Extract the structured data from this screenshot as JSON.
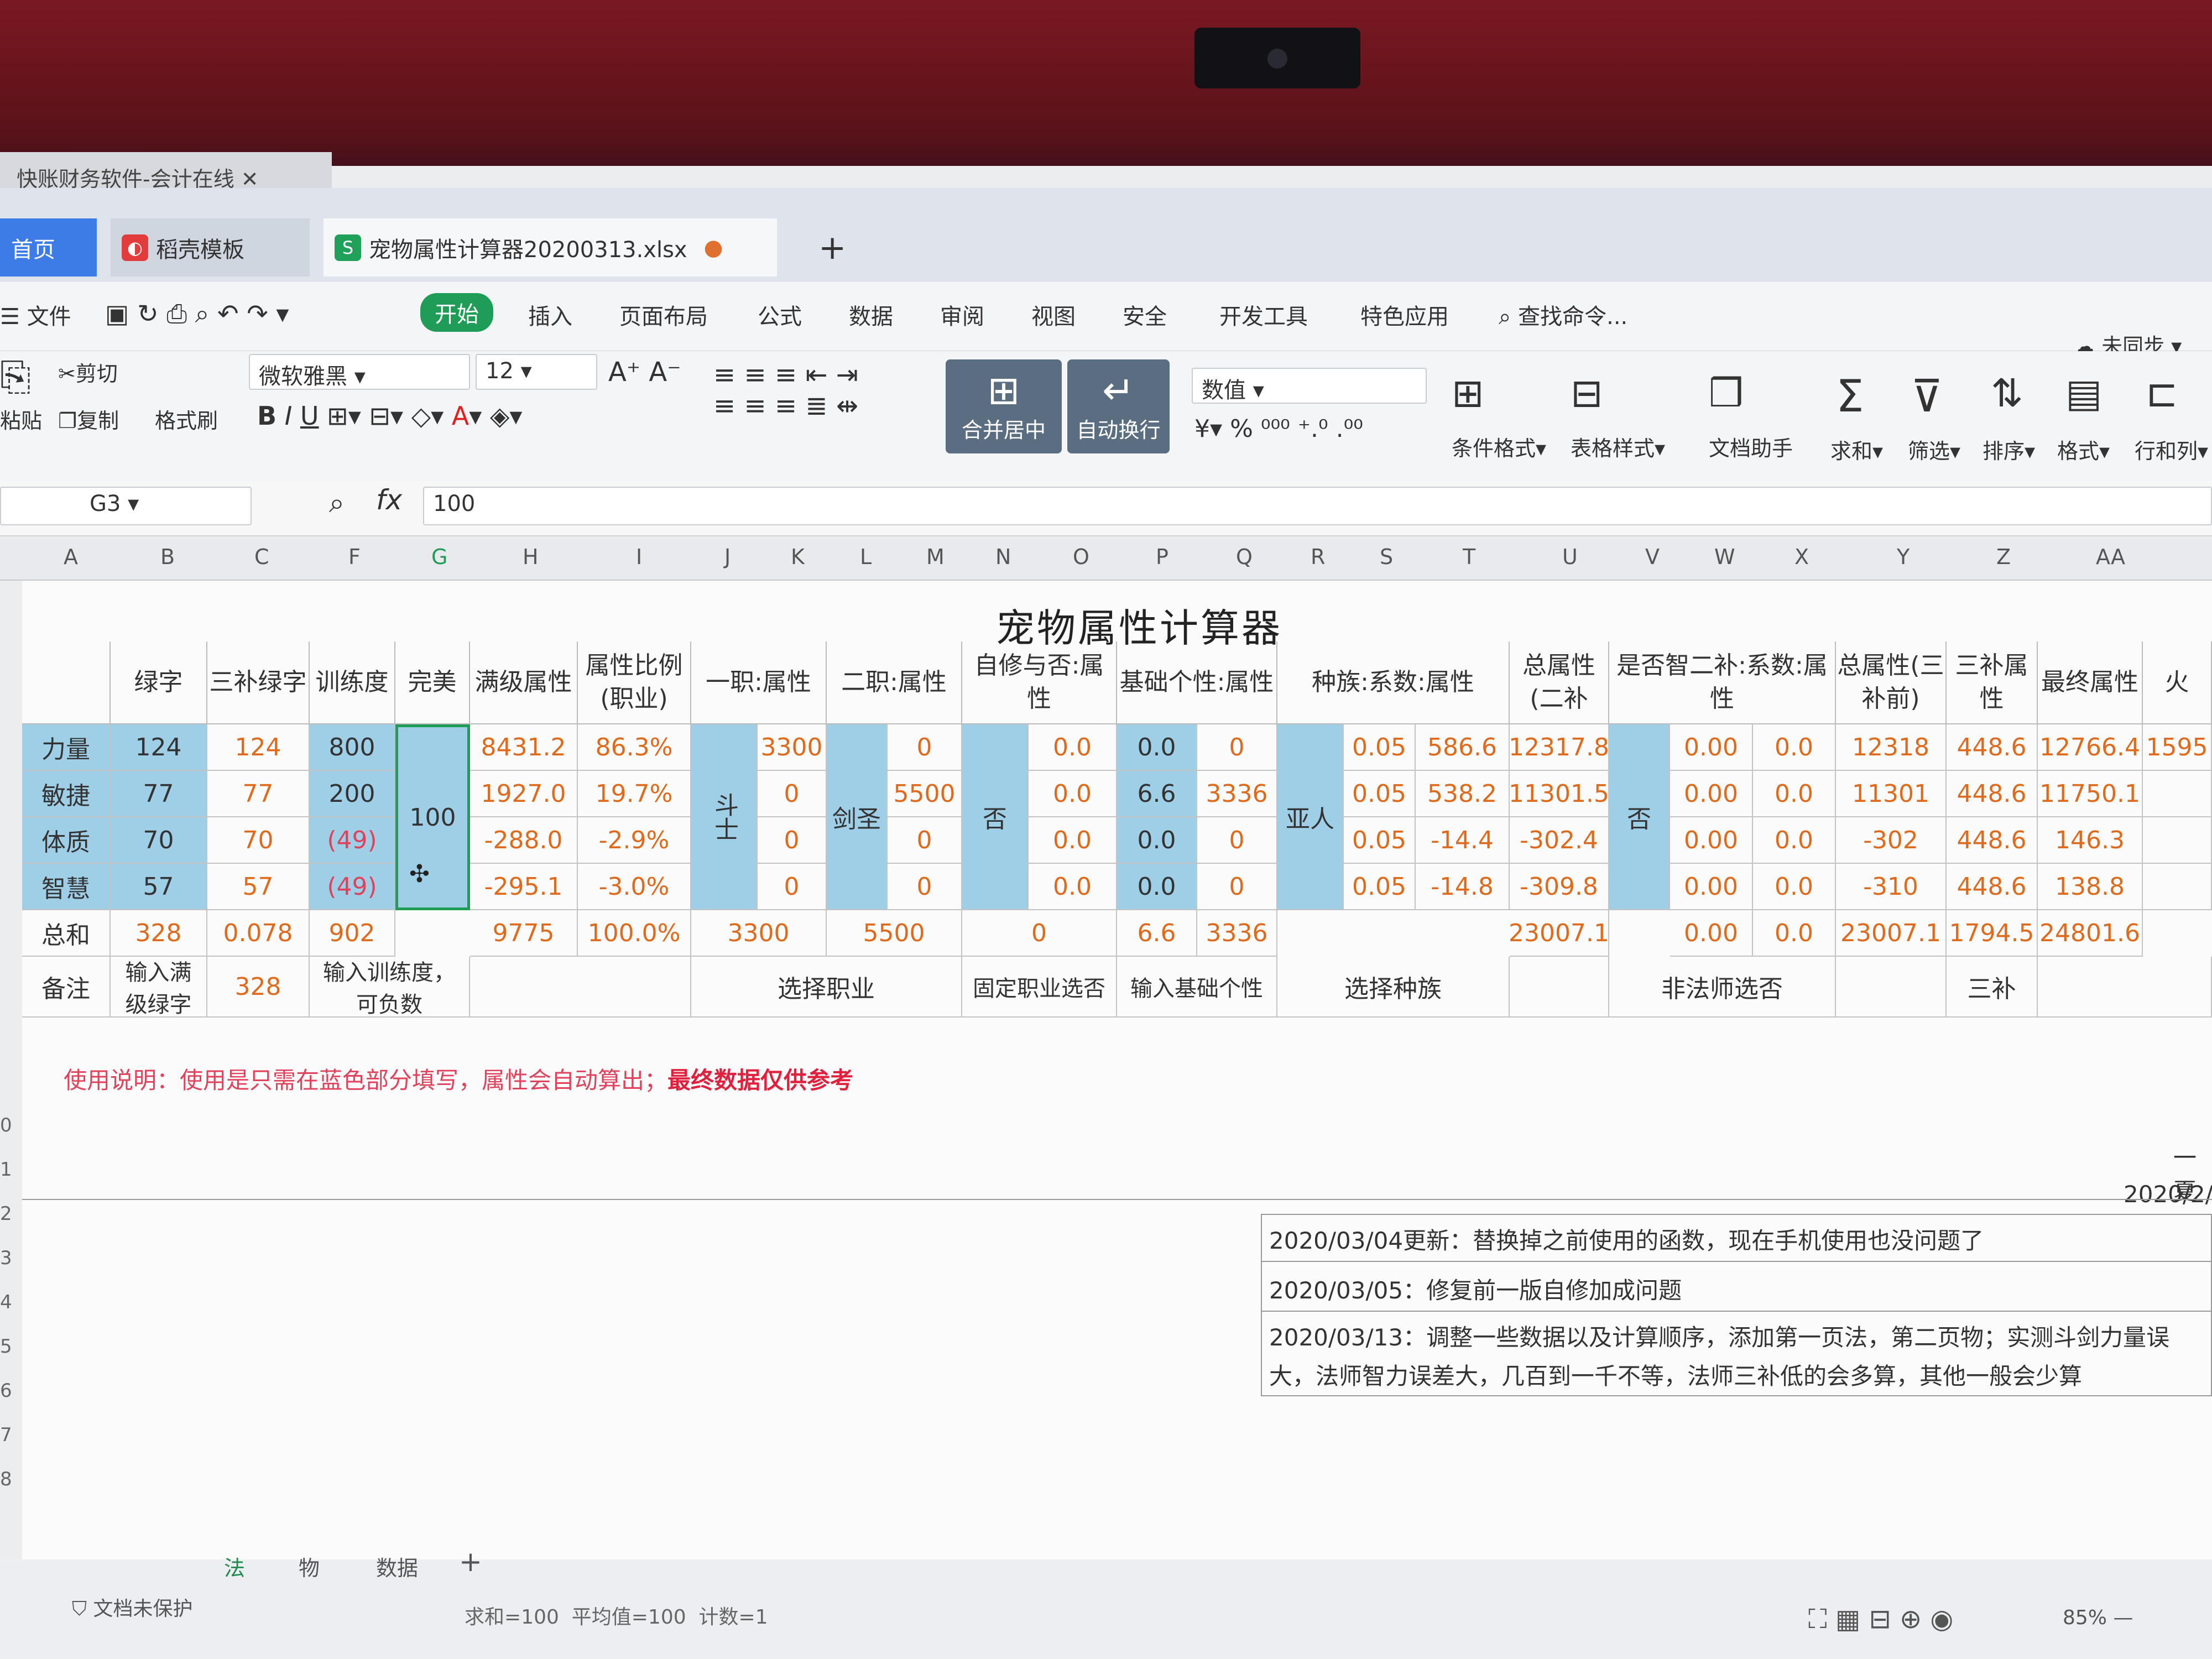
{
  "old_tab": {
    "title": "快账财务软件-会计在线"
  },
  "tabs": {
    "home": "首页",
    "template": "稻壳模板",
    "file": "宠物属性计算器20200313.xlsx",
    "add": "+"
  },
  "menu": {
    "file": "文件",
    "start": "开始",
    "insert": "插入",
    "layout": "页面布局",
    "formula": "公式",
    "data": "数据",
    "review": "审阅",
    "view": "视图",
    "security": "安全",
    "dev": "开发工具",
    "special": "特色应用",
    "search": "查找命令...",
    "sync": "未同步"
  },
  "toolbar": {
    "paste": "粘贴",
    "cut": "剪切",
    "copy": "复制",
    "format_painter": "格式刷",
    "font": "微软雅黑",
    "size": "12",
    "merge": "合并居中",
    "wrap": "自动换行",
    "number_format": "数值",
    "cond_format": "条件格式",
    "table_style": "表格样式",
    "doc_helper": "文档助手",
    "sum": "求和",
    "filter": "筛选",
    "sort": "排序",
    "format": "格式",
    "rowcol": "行和列"
  },
  "formula_bar": {
    "cell": "G3",
    "fx": "fx",
    "value": "100"
  },
  "columns": [
    "A",
    "B",
    "C",
    "F",
    "G",
    "H",
    "I",
    "J",
    "K",
    "L",
    "M",
    "N",
    "O",
    "P",
    "Q",
    "R",
    "S",
    "T",
    "U",
    "V",
    "W",
    "X",
    "Y",
    "Z",
    "AA"
  ],
  "sheet": {
    "title": "宠物属性计算器",
    "headers": {
      "b": "绿字",
      "c": "三补绿字",
      "f": "训练度",
      "g": "完美",
      "h": "满级属性",
      "i": "属性比例(职业)",
      "job1": "一职:属性",
      "job2": "二职:属性",
      "self": "自修与否:属性",
      "base": "基础个性:属性",
      "race": "种族:系数:属性",
      "total2": "总属性(二补",
      "wise": "是否智二补:系数:属性",
      "total3": "总属性(三补前)",
      "b3": "三补属性",
      "final": "最终属性",
      "fire": "火"
    },
    "rows": [
      {
        "name": "力量",
        "b": "124",
        "c": "124",
        "f": "800",
        "h": "8431.2",
        "i": "86.3%",
        "k": "3300",
        "m": "0",
        "o": "0.0",
        "p": "0.0",
        "q": "0",
        "s": "0.05",
        "t": "586.6",
        "u": "12317.8",
        "w": "0.00",
        "x": "0.0",
        "y": "12318",
        "z": "448.6",
        "aa": "12766.4",
        "ab": "1595"
      },
      {
        "name": "敏捷",
        "b": "77",
        "c": "77",
        "f": "200",
        "h": "1927.0",
        "i": "19.7%",
        "k": "0",
        "m": "5500",
        "o": "0.0",
        "p": "6.6",
        "q": "3336",
        "s": "0.05",
        "t": "538.2",
        "u": "11301.5",
        "w": "0.00",
        "x": "0.0",
        "y": "11301",
        "z": "448.6",
        "aa": "11750.1",
        "ab": ""
      },
      {
        "name": "体质",
        "b": "70",
        "c": "70",
        "f": "(49)",
        "h": "-288.0",
        "i": "-2.9%",
        "k": "0",
        "m": "0",
        "o": "0.0",
        "p": "0.0",
        "q": "0",
        "s": "0.05",
        "t": "-14.4",
        "u": "-302.4",
        "w": "0.00",
        "x": "0.0",
        "y": "-302",
        "z": "448.6",
        "aa": "146.3",
        "ab": ""
      },
      {
        "name": "智慧",
        "b": "57",
        "c": "57",
        "f": "(49)",
        "h": "-295.1",
        "i": "-3.0%",
        "k": "0",
        "m": "0",
        "o": "0.0",
        "p": "0.0",
        "q": "0",
        "s": "0.05",
        "t": "-14.8",
        "u": "-309.8",
        "w": "0.00",
        "x": "0.0",
        "y": "-310",
        "z": "448.6",
        "aa": "138.8",
        "ab": ""
      }
    ],
    "merged": {
      "perfect": "100",
      "job1": "斗士",
      "job2": "剑圣",
      "self": "否",
      "race": "亚人",
      "wise": "否"
    },
    "total": {
      "name": "总和",
      "b": "328",
      "c": "0.078",
      "f": "902",
      "h": "9775",
      "i": "100.0%",
      "k": "3300",
      "m": "5500",
      "o": "0",
      "p": "6.6",
      "q": "3336",
      "u": "23007.1",
      "w": "0.00",
      "x": "0.0",
      "y": "23007.1",
      "z": "1794.5",
      "aa": "24801.6"
    },
    "notes": {
      "name": "备注",
      "b": "输入满级绿字",
      "c": "328",
      "f": "输入训练度，可负数",
      "job": "选择职业",
      "self": "固定职业选否",
      "base": "输入基础个性",
      "race": "选择种族",
      "wise": "非法师选否",
      "b3": "三补"
    },
    "usage_label": "使用说明：",
    "usage_text": "使用是只需在蓝色部分填写，属性会自动算出；",
    "usage_warn": "最终数据仅供参考",
    "corner1": "一夏",
    "corner2": "2020/2/",
    "changelog": [
      "2020/03/04更新：替换掉之前使用的函数，现在手机使用也没问题了",
      "2020/03/05：修复前一版自修加成问题",
      "2020/03/13：调整一些数据以及计算顺序，添加第一页法，第二页物；实测斗剑力量误",
      "大，法师智力误差大，几百到一千不等，法师三补低的会多算，其他一般会少算"
    ],
    "row_numbers": [
      "0",
      "1",
      "2",
      "3",
      "4",
      "5",
      "6",
      "7",
      "8"
    ]
  },
  "sheet_tabs": [
    "法",
    "物",
    "数据",
    "+"
  ],
  "status": {
    "protect": "文档未保护",
    "stats": "求和=100  平均值=100  计数=1",
    "zoom": "85%"
  }
}
